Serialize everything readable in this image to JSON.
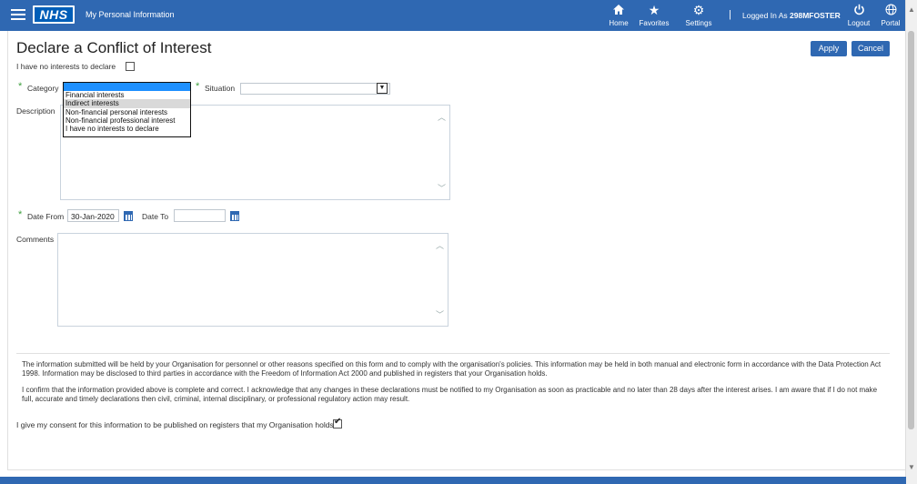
{
  "header": {
    "logo_text": "NHS",
    "app_title": "My Personal Information",
    "nav": [
      {
        "label": "Home",
        "icon": "home-icon"
      },
      {
        "label": "Favorites",
        "icon": "star-icon"
      },
      {
        "label": "Settings",
        "icon": "gear-icon"
      }
    ],
    "separator": "|",
    "logged_in_prefix": "Logged In As",
    "logged_in_user": "298MFOSTER",
    "logout_label": "Logout",
    "portal_label": "Portal"
  },
  "page": {
    "title": "Declare a Conflict of Interest",
    "apply_label": "Apply",
    "cancel_label": "Cancel"
  },
  "form": {
    "no_interests_label": "I have no interests to declare",
    "no_interests_checked": false,
    "category_label": "Category",
    "category_value": "",
    "category_options": [
      "",
      "Financial interests",
      "Indirect interests",
      "Non-financial personal interests",
      "Non-financial professional interest",
      "I have no interests to declare"
    ],
    "highlighted_option": "Indirect interests",
    "situation_label": "Situation",
    "situation_value": "",
    "description_label": "Description",
    "date_from_label": "Date From",
    "date_from_value": "30-Jan-2020",
    "date_to_label": "Date To",
    "date_to_value": "",
    "comments_label": "Comments"
  },
  "footer": {
    "info_text": "The information submitted will be held by your Organisation for personnel or other reasons specified on this form and to comply with the organisation's policies. This information may be held in both manual and electronic form in accordance with the Data Protection Act 1998. Information may be disclosed to third parties in accordance with the Freedom of Information Act 2000 and published in registers that your Organisation holds.",
    "confirm_text": "I confirm that the information provided above is complete and correct. I acknowledge that any changes in these declarations must be notified to my Organisation as soon as practicable and no later than 28 days after the interest arises. I am aware that if I do not make full, accurate and timely declarations then civil, criminal, internal disciplinary, or professional regulatory action may result.",
    "consent_label": "I give my consent for this information to be published on registers that my Organisation holds.",
    "consent_checked": true
  },
  "colors": {
    "brand_blue": "#2f68b2",
    "nhs_blue": "#005eb8",
    "required_green": "#3f9f3f",
    "highlight_blue": "#1e90ff"
  }
}
